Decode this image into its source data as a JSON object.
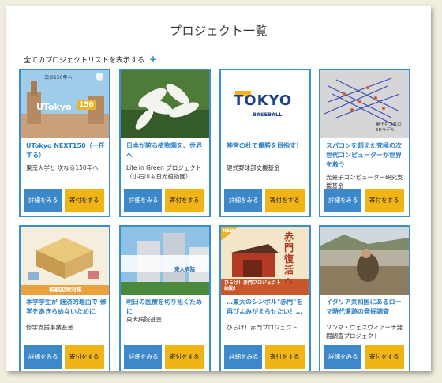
{
  "header": {
    "title": "プロジェクト一覧"
  },
  "list_link": {
    "label": "全てのプロジェクトリストを表示する",
    "plus": "+"
  },
  "cards": [
    {
      "title": "UTokyo NEXT150（一任する）",
      "org": "東京大学と 次なる150年へ",
      "detail": "詳細をみる",
      "donate": "寄付をする",
      "thumb_text": "UTokyo",
      "thumb_sub": "150",
      "thumb_caption": "次の150年へ"
    },
    {
      "title": "日本が誇る植物園を、世界へ",
      "org": "Life in Green プロジェクト（小石川＆日光植物園）",
      "detail": "詳細をみる",
      "donate": "寄付をする"
    },
    {
      "title": "神宮の杜で優勝を目指す！",
      "org": "硬式野球部支援基金",
      "detail": "詳細をみる",
      "donate": "寄付をする",
      "thumb_text": "TOKYO",
      "thumb_sub": "BASEBALL"
    },
    {
      "title": "スパコンを超えた究極の次世代コンピューターが世界を救う",
      "org": "光量子コンピューター研究支援基金",
      "detail": "詳細をみる",
      "donate": "寄付をする",
      "thumb_caption": "量子もつれの3Dモデル"
    },
    {
      "title": "本学学生が 経済的理由で 修学をあきらめないために",
      "org": "修学支援事業基金",
      "detail": "詳細をみる",
      "donate": "寄付をする",
      "thumb_caption": "税額控除対象"
    },
    {
      "title": "明日の医療を切り拓くために",
      "org": "東大病院基金",
      "detail": "詳細をみる",
      "donate": "寄付をする",
      "thumb_text": "東大病院"
    },
    {
      "title": "…東大のシンボル\"赤門\"を再びよみがえらせたい！…",
      "org": "ひらけ！赤門プロジェクト",
      "detail": "詳細をみる",
      "donate": "寄付をする",
      "thumb_text": "赤門 復活へ",
      "thumb_sub": "NEW",
      "thumb_caption": "ひらけ！赤門プロジェクト始動！"
    },
    {
      "title": "イタリア共和国にあるローマ時代遺跡の発掘調査",
      "org": "ソンマ・ヴェスヴィアーナ発掘調査プロジェクト",
      "detail": "詳細をみる",
      "donate": "寄付をする"
    }
  ],
  "colors": {
    "accent": "#2f87c8",
    "donate": "#f0b417",
    "detail": "#3d88c8"
  }
}
